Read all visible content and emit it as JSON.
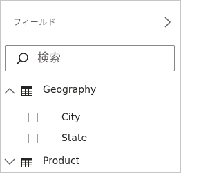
{
  "pane": {
    "title": "フィールド",
    "expand_icon": "chevron-right-icon"
  },
  "search": {
    "placeholder": "検索",
    "value": ""
  },
  "tables": [
    {
      "label": "Geography",
      "expanded": true,
      "fields": [
        {
          "label": "City",
          "checked": false
        },
        {
          "label": "State",
          "checked": false
        }
      ]
    },
    {
      "label": "Product",
      "expanded": false,
      "fields": []
    }
  ],
  "colors": {
    "text": "#252423",
    "muted": "#605e5c",
    "border": "#c8c6c4"
  }
}
